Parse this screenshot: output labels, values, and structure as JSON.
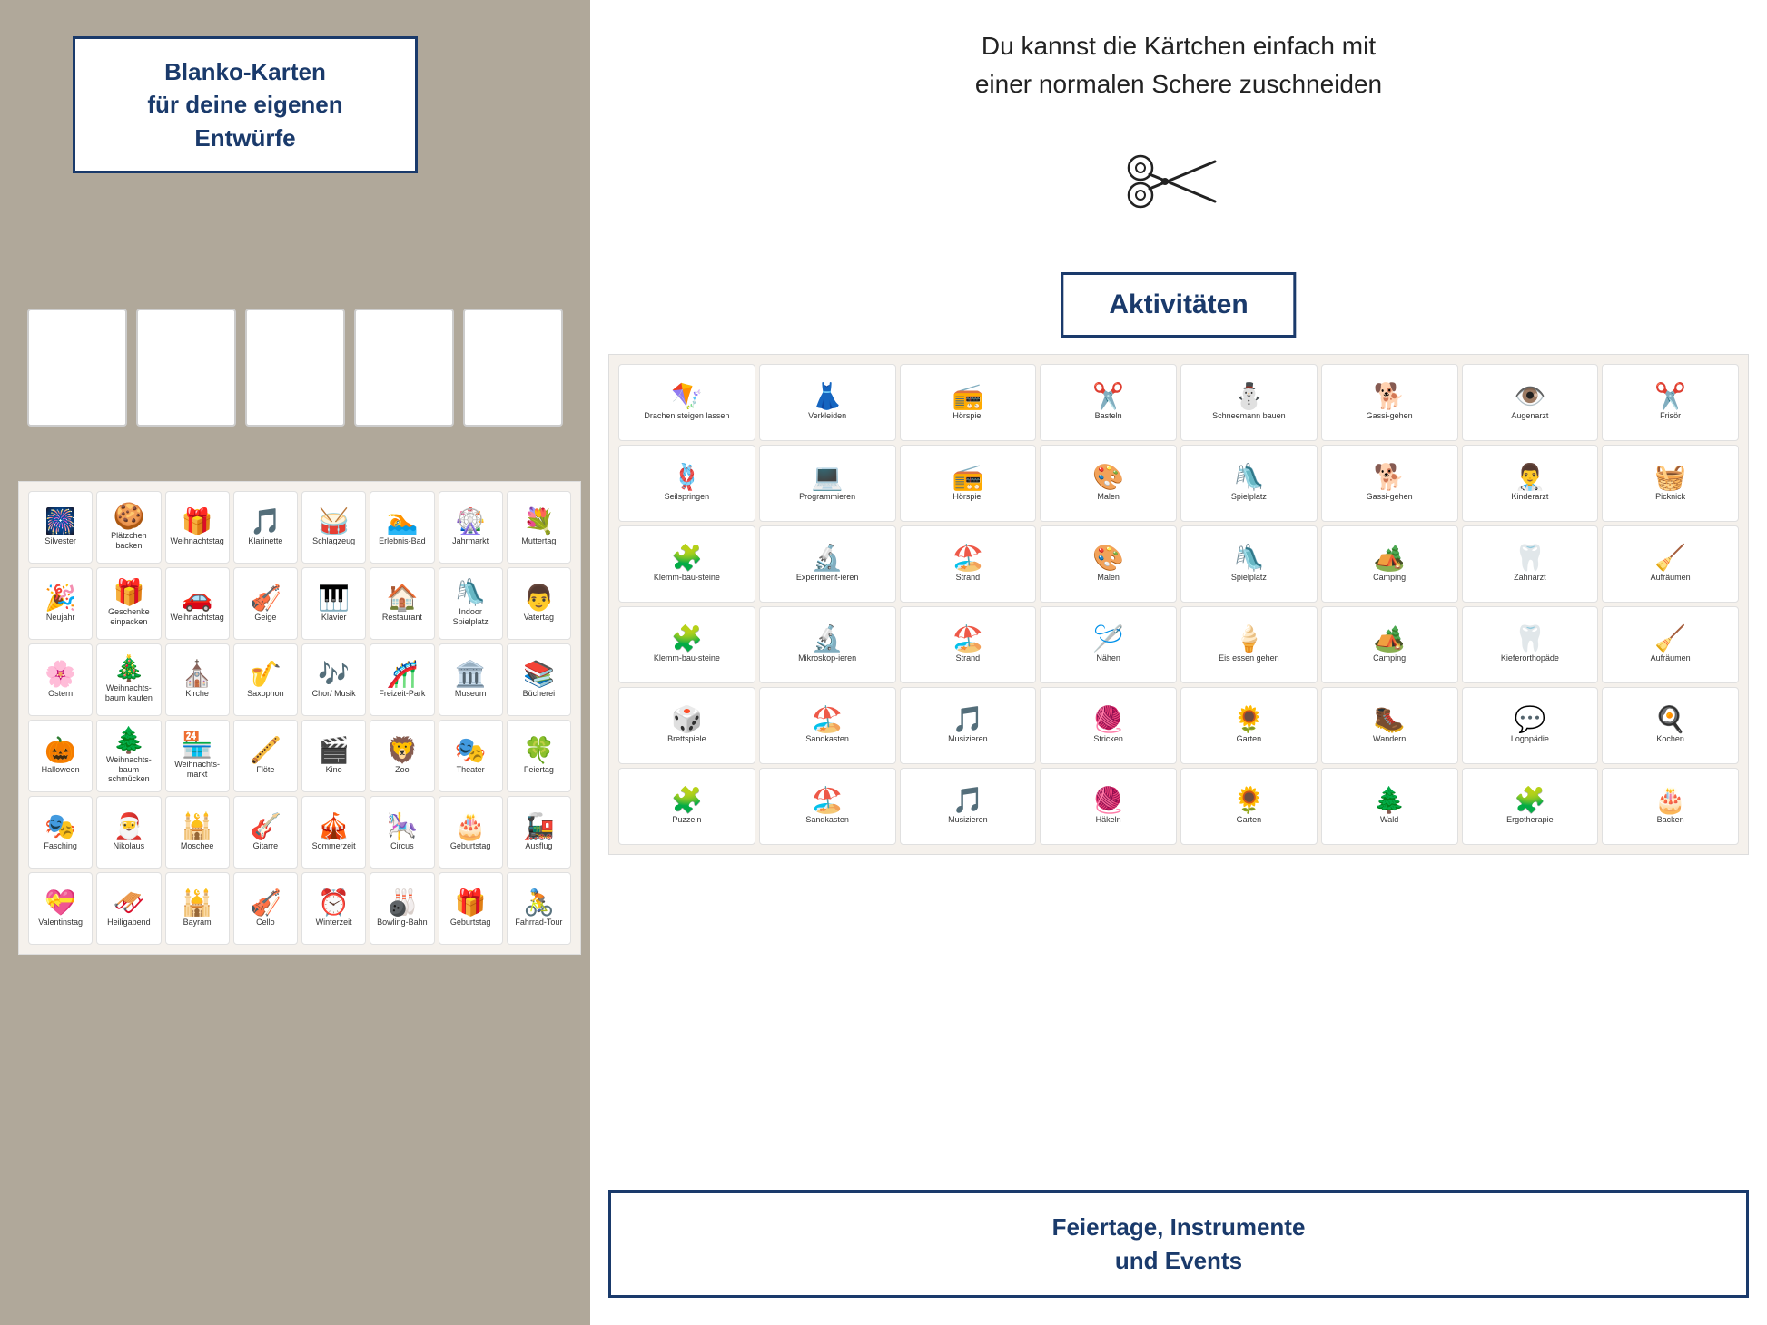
{
  "left": {
    "blanko": {
      "title": "Blanko-Karten\nfür deine eigenen\nEntwürfe"
    },
    "grid_items": [
      {
        "emoji": "🎆",
        "label": "Silvester"
      },
      {
        "emoji": "🍪",
        "label": "Plätzchen backen"
      },
      {
        "emoji": "🎁",
        "label": "Weihnachtstag"
      },
      {
        "emoji": "🎵",
        "label": "Klarinette"
      },
      {
        "emoji": "🥁",
        "label": "Schlagzeug"
      },
      {
        "emoji": "🏊",
        "label": "Erlebnis-Bad"
      },
      {
        "emoji": "🎡",
        "label": "Jahrmarkt"
      },
      {
        "emoji": "💐",
        "label": "Muttertag"
      },
      {
        "emoji": "🎉",
        "label": "Neujahr"
      },
      {
        "emoji": "🎁",
        "label": "Geschenke einpacken"
      },
      {
        "emoji": "🚗",
        "label": "Weihnachtstag"
      },
      {
        "emoji": "🎻",
        "label": "Geige"
      },
      {
        "emoji": "🎹",
        "label": "Klavier"
      },
      {
        "emoji": "🏠",
        "label": "Restaurant"
      },
      {
        "emoji": "🛝",
        "label": "Indoor Spielplatz"
      },
      {
        "emoji": "👨",
        "label": "Vatertag"
      },
      {
        "emoji": "🌸",
        "label": "Ostern"
      },
      {
        "emoji": "🎄",
        "label": "Weihnachts-baum kaufen"
      },
      {
        "emoji": "⛪",
        "label": "Kirche"
      },
      {
        "emoji": "🎷",
        "label": "Saxophon"
      },
      {
        "emoji": "🎶",
        "label": "Chor/ Musik"
      },
      {
        "emoji": "🎢",
        "label": "Freizeit-Park"
      },
      {
        "emoji": "🏛️",
        "label": "Museum"
      },
      {
        "emoji": "📚",
        "label": "Bücherei"
      },
      {
        "emoji": "🎃",
        "label": "Halloween"
      },
      {
        "emoji": "🌲",
        "label": "Weihnachts-baum schmücken"
      },
      {
        "emoji": "🏪",
        "label": "Weihnachts-markt"
      },
      {
        "emoji": "🪈",
        "label": "Flöte"
      },
      {
        "emoji": "🎬",
        "label": "Kino"
      },
      {
        "emoji": "🦁",
        "label": "Zoo"
      },
      {
        "emoji": "🎭",
        "label": "Theater"
      },
      {
        "emoji": "🍀",
        "label": "Feiertag"
      },
      {
        "emoji": "🎭",
        "label": "Fasching"
      },
      {
        "emoji": "🎅",
        "label": "Nikolaus"
      },
      {
        "emoji": "🕌",
        "label": "Moschee"
      },
      {
        "emoji": "🎸",
        "label": "Gitarre"
      },
      {
        "emoji": "🎪",
        "label": "Sommerzeit"
      },
      {
        "emoji": "🎠",
        "label": "Circus"
      },
      {
        "emoji": "🎂",
        "label": "Geburtstag"
      },
      {
        "emoji": "🚂",
        "label": "Ausflug"
      },
      {
        "emoji": "💝",
        "label": "Valentinstag"
      },
      {
        "emoji": "🛷",
        "label": "Heiligabend"
      },
      {
        "emoji": "🕌",
        "label": "Bayram"
      },
      {
        "emoji": "🎻",
        "label": "Cello"
      },
      {
        "emoji": "⏰",
        "label": "Winterzeit"
      },
      {
        "emoji": "🎳",
        "label": "Bowling-Bahn"
      },
      {
        "emoji": "🎁",
        "label": "Geburtstag"
      },
      {
        "emoji": "🚴",
        "label": "Fahrrad-Tour"
      }
    ]
  },
  "right": {
    "top_text": "Du kannst die Kärtchen einfach mit\neiner normalen Schere zuschneiden",
    "aktivitaeten": "Aktivitäten",
    "activities": [
      {
        "emoji": "🪁",
        "label": "Drachen steigen lassen"
      },
      {
        "emoji": "👗",
        "label": "Verkleiden"
      },
      {
        "emoji": "📻",
        "label": "Hörspiel"
      },
      {
        "emoji": "✂️",
        "label": "Basteln"
      },
      {
        "emoji": "⛄",
        "label": "Schneemann bauen"
      },
      {
        "emoji": "🐕",
        "label": "Gassi-gehen"
      },
      {
        "emoji": "👁️",
        "label": "Augenarzt"
      },
      {
        "emoji": "✂️",
        "label": "Frisör"
      },
      {
        "emoji": "🪢",
        "label": "Seilspringen"
      },
      {
        "emoji": "💻",
        "label": "Programmieren"
      },
      {
        "emoji": "📻",
        "label": "Hörspiel"
      },
      {
        "emoji": "🎨",
        "label": "Malen"
      },
      {
        "emoji": "🛝",
        "label": "Spielplatz"
      },
      {
        "emoji": "🐕",
        "label": "Gassi-gehen"
      },
      {
        "emoji": "👨‍⚕️",
        "label": "Kinderarzt"
      },
      {
        "emoji": "🧺",
        "label": "Picknick"
      },
      {
        "emoji": "🧩",
        "label": "Klemm-bau-steine"
      },
      {
        "emoji": "🔬",
        "label": "Experiment-ieren"
      },
      {
        "emoji": "🏖️",
        "label": "Strand"
      },
      {
        "emoji": "🎨",
        "label": "Malen"
      },
      {
        "emoji": "🛝",
        "label": "Spielplatz"
      },
      {
        "emoji": "🏕️",
        "label": "Camping"
      },
      {
        "emoji": "🦷",
        "label": "Zahnarzt"
      },
      {
        "emoji": "🧹",
        "label": "Aufräumen"
      },
      {
        "emoji": "🧩",
        "label": "Klemm-bau-steine"
      },
      {
        "emoji": "🔬",
        "label": "Mikroskop-ieren"
      },
      {
        "emoji": "🏖️",
        "label": "Strand"
      },
      {
        "emoji": "🪡",
        "label": "Nähen"
      },
      {
        "emoji": "🍦",
        "label": "Eis essen gehen"
      },
      {
        "emoji": "🏕️",
        "label": "Camping"
      },
      {
        "emoji": "🦷",
        "label": "Kieferorthopäde"
      },
      {
        "emoji": "🧹",
        "label": "Aufräumen"
      },
      {
        "emoji": "🎲",
        "label": "Brettspiele"
      },
      {
        "emoji": "🏖️",
        "label": "Sandkasten"
      },
      {
        "emoji": "🎵",
        "label": "Musizieren"
      },
      {
        "emoji": "🧶",
        "label": "Stricken"
      },
      {
        "emoji": "🌻",
        "label": "Garten"
      },
      {
        "emoji": "🥾",
        "label": "Wandern"
      },
      {
        "emoji": "💬",
        "label": "Logopädie"
      },
      {
        "emoji": "🍳",
        "label": "Kochen"
      },
      {
        "emoji": "🧩",
        "label": "Puzzeln"
      },
      {
        "emoji": "🏖️",
        "label": "Sandkasten"
      },
      {
        "emoji": "🎵",
        "label": "Musizieren"
      },
      {
        "emoji": "🧶",
        "label": "Häkeln"
      },
      {
        "emoji": "🌻",
        "label": "Garten"
      },
      {
        "emoji": "🌲",
        "label": "Wald"
      },
      {
        "emoji": "🧩",
        "label": "Ergotherapie"
      },
      {
        "emoji": "🎂",
        "label": "Backen"
      }
    ],
    "feiertage": {
      "title": "Feiertage, Instrumente\nund Events"
    }
  }
}
